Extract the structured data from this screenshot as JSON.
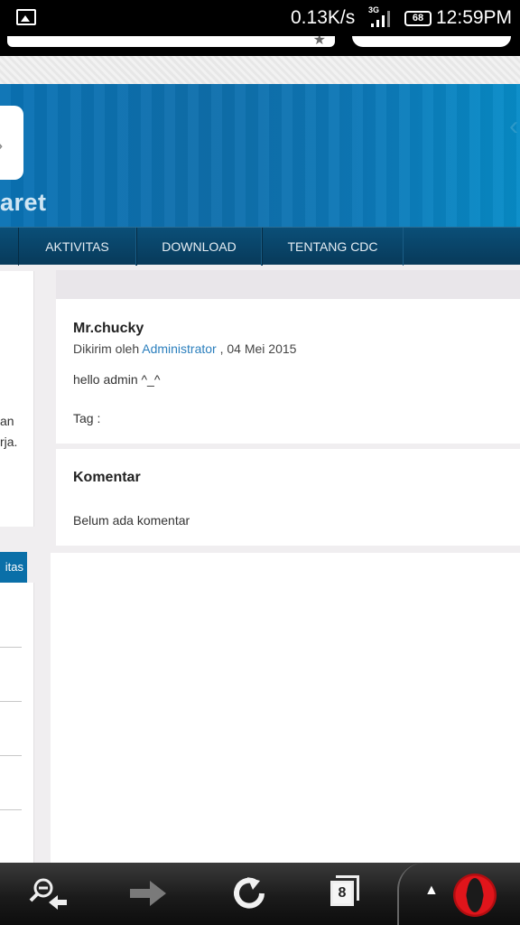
{
  "status_bar": {
    "speed": "0.13K/s",
    "network": "3G",
    "battery": "68",
    "time": "12:59PM",
    "icons": [
      "image-icon",
      "signal-icon",
      "battery-icon"
    ]
  },
  "banner": {
    "site_name_fragment": "aret"
  },
  "nav": {
    "items": [
      {
        "label": "AKTIVITAS"
      },
      {
        "label": "DOWNLOAD"
      },
      {
        "label": "TENTANG CDC"
      }
    ]
  },
  "sidebar": {
    "fragments": [
      "an",
      "rja."
    ],
    "button_label": "itas"
  },
  "post": {
    "title": "Mr.chucky",
    "meta_prefix": "Dikirim  oleh",
    "author": "Administrator",
    "meta_date": " , 04 Mei 2015",
    "body": "hello admin ^_^",
    "tag_label": "Tag  :"
  },
  "comments": {
    "heading": "Komentar",
    "empty_text": "Belum ada  komentar"
  },
  "bottom_bar": {
    "tab_count": "8",
    "icons": [
      "zoom-out-back-icon",
      "forward-arrow-icon",
      "reload-icon",
      "tabs-icon",
      "up-arrow-icon",
      "opera-logo-icon"
    ]
  },
  "colors": {
    "banner": "#0a73b5",
    "nav": "#083a5a",
    "link": "#2b7fbd",
    "sidebar_button": "#0a6fa8"
  }
}
